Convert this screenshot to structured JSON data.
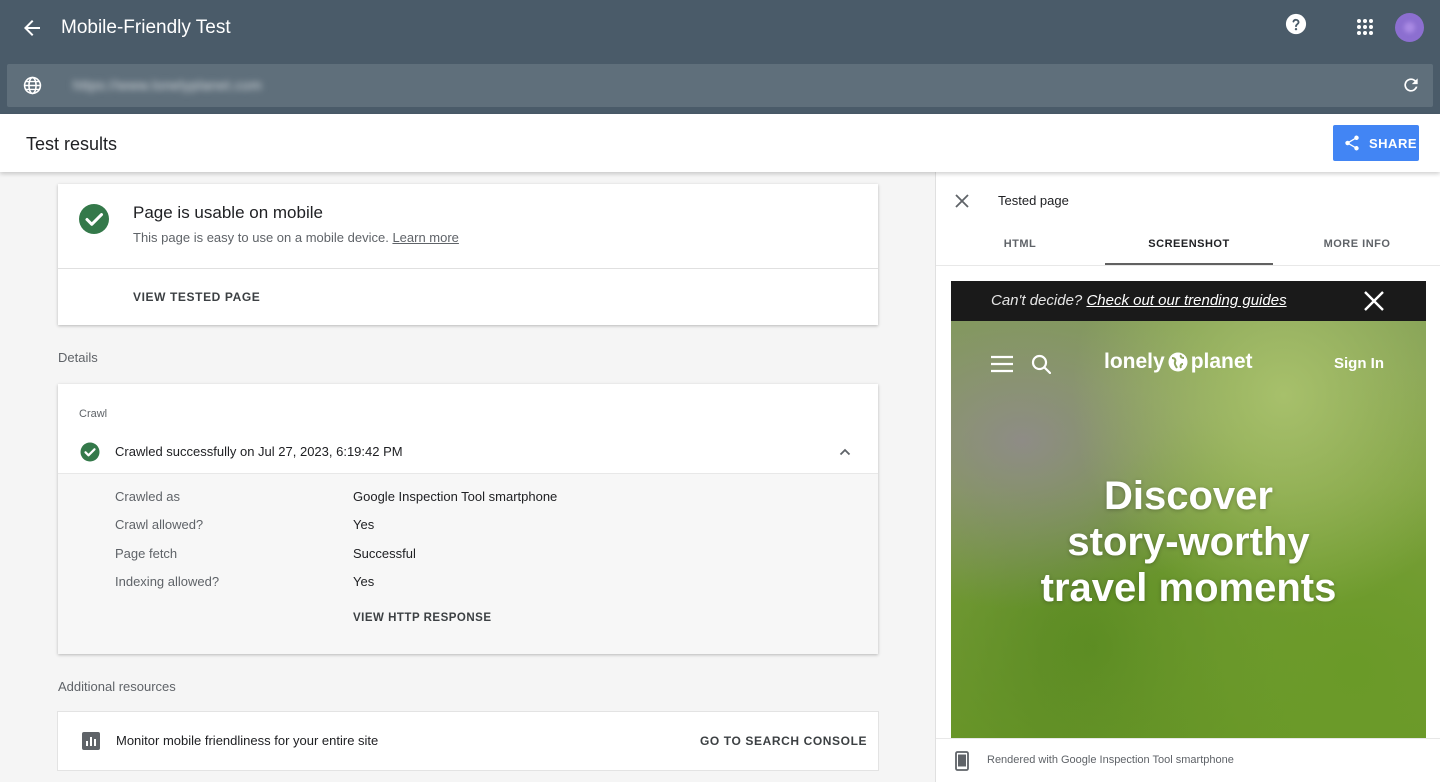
{
  "app": {
    "title": "Mobile-Friendly Test"
  },
  "url_bar": {
    "url": "https://www.lonelyplanet.com"
  },
  "results": {
    "title": "Test results",
    "share_label": "SHARE"
  },
  "usable_card": {
    "heading": "Page is usable on mobile",
    "description": "This page is easy to use on a mobile device.",
    "learn_more": "Learn more",
    "view_tested_page": "VIEW TESTED PAGE",
    "status_color": "#34794a"
  },
  "details": {
    "label": "Details",
    "crawl": {
      "title": "Crawl",
      "status": "Crawled successfully on Jul 27, 2023, 6:19:42 PM",
      "rows": [
        {
          "key": "Crawled as",
          "value": "Google Inspection Tool smartphone"
        },
        {
          "key": "Crawl allowed?",
          "value": "Yes"
        },
        {
          "key": "Page fetch",
          "value": "Successful"
        },
        {
          "key": "Indexing allowed?",
          "value": "Yes"
        }
      ],
      "view_http_response": "VIEW HTTP RESPONSE"
    }
  },
  "additional": {
    "label": "Additional resources",
    "monitor_text": "Monitor mobile friendliness for your entire site",
    "go_label": "GO TO SEARCH CONSOLE"
  },
  "panel": {
    "title": "Tested page",
    "tabs": [
      "HTML",
      "SCREENSHOT",
      "MORE INFO"
    ],
    "active_tab": "SCREENSHOT",
    "footer": "Rendered with Google Inspection Tool smartphone",
    "screenshot": {
      "banner_prefix": "Can't decide?",
      "banner_link": "Check out our trending guides",
      "logo_left": "lonely",
      "logo_right": "planet",
      "sign_in": "Sign In",
      "hero_line1": "Discover",
      "hero_line2": "story-worthy",
      "hero_line3": "travel moments"
    }
  },
  "colors": {
    "header": "#4a5b69",
    "url_bar": "#5f6f7b",
    "accent": "#4285f4",
    "success": "#34794a"
  }
}
